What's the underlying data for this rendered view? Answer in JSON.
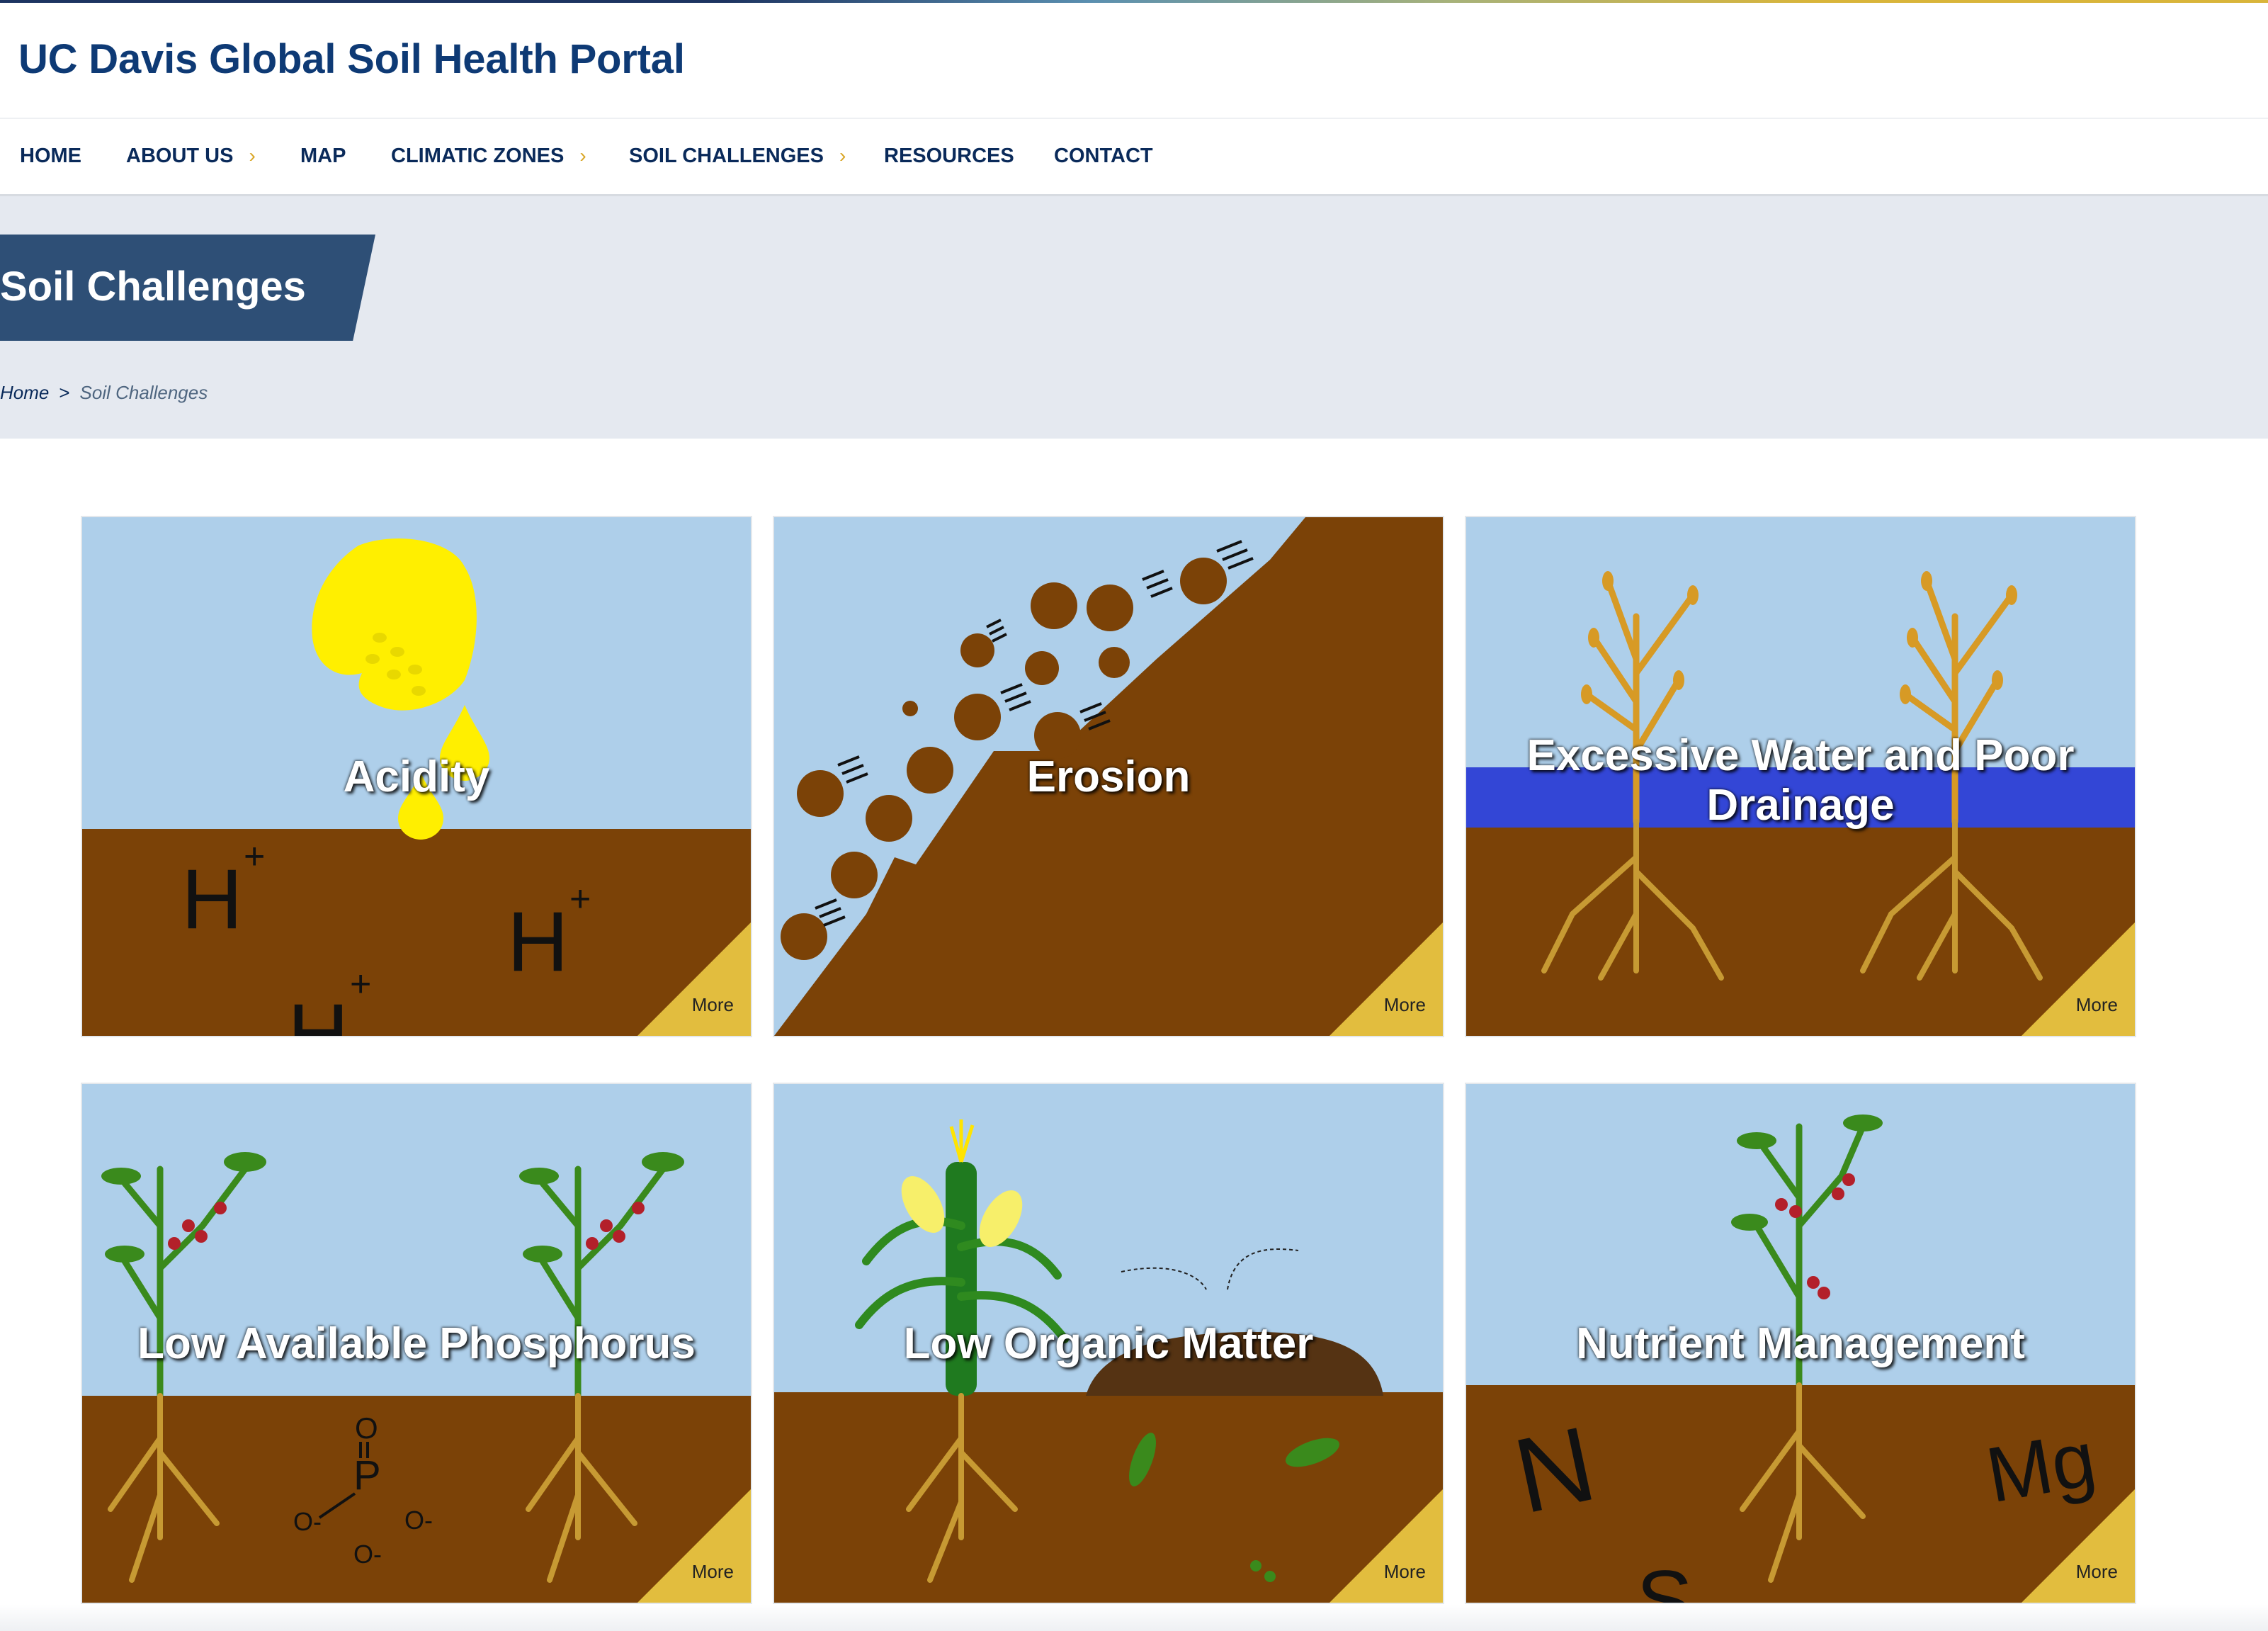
{
  "site": {
    "title": "UC Davis Global Soil Health Portal"
  },
  "nav": {
    "items": [
      {
        "label": "HOME",
        "has_submenu": false
      },
      {
        "label": "ABOUT US",
        "has_submenu": true
      },
      {
        "label": "MAP",
        "has_submenu": false
      },
      {
        "label": "CLIMATIC ZONES",
        "has_submenu": true
      },
      {
        "label": "SOIL CHALLENGES",
        "has_submenu": true
      },
      {
        "label": "RESOURCES",
        "has_submenu": false
      },
      {
        "label": "CONTACT",
        "has_submenu": false
      }
    ],
    "submenu_glyph": "›"
  },
  "page": {
    "title": "Soil Challenges"
  },
  "breadcrumb": {
    "home": "Home",
    "separator": ">",
    "current": "Soil Challenges"
  },
  "cards": [
    {
      "title": "Acidity",
      "more": "More",
      "illustration": "lemon-drop-acidity",
      "labels": [
        "H",
        "H",
        "H"
      ],
      "superscript": "+"
    },
    {
      "title": "Erosion",
      "more": "More",
      "illustration": "eroding-hillside"
    },
    {
      "title": "Excessive Water and Poor Drainage",
      "more": "More",
      "illustration": "waterlogged-plants"
    },
    {
      "title": "Low Available Phosphorus",
      "more": "More",
      "illustration": "phosphate-plants",
      "labels": [
        "O",
        "P",
        "O-",
        "O-",
        "O-"
      ]
    },
    {
      "title": "Low Organic Matter",
      "more": "More",
      "illustration": "corn-and-compost"
    },
    {
      "title": "Nutrient Management",
      "more": "More",
      "illustration": "nutrients-plant",
      "labels": [
        "N",
        "S",
        "Mg"
      ]
    }
  ],
  "colors": {
    "sky": "#aecfea",
    "soil": "#7b4207",
    "accent_gold": "#e2bd3e",
    "banner": "#2e4f76",
    "brand_blue": "#0e3a75",
    "water": "#3346d6",
    "lemon": "#ffef00"
  }
}
